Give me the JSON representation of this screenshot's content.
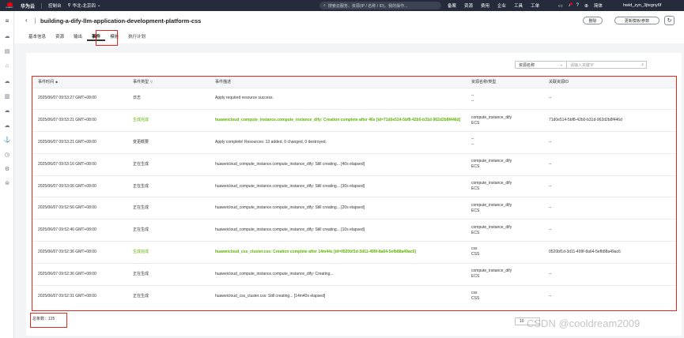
{
  "topbar": {
    "logo_text": "HUAWEI",
    "brand": "华为云",
    "console": "控制台",
    "region": "华北-北京四",
    "search_placeholder": "搜索云服务、资源(IP / 名称 / ID)、我的操作...",
    "nav": [
      "备案",
      "资源",
      "费用",
      "企业",
      "工具",
      "工单"
    ],
    "lang": "简体",
    "user": "hwid_zyn_3jtegny6f"
  },
  "header": {
    "title": "building-a-dify-llm-application-development-platform-css",
    "delete_label": "删除",
    "update_label": "更新模板/参数"
  },
  "tabs": [
    "基本信息",
    "资源",
    "输出",
    "事件",
    "模板",
    "执行计划"
  ],
  "active_tab": 3,
  "filter": {
    "select_value": "资源名称",
    "keyword_placeholder": "请输入关键字"
  },
  "table": {
    "columns": [
      "事件时间",
      "事件类型",
      "事件描述",
      "资源名称/类型",
      "关联资源ID"
    ],
    "rows": [
      {
        "time": "2025/06/07 09:53:27 GMT+08:00",
        "type": "日志",
        "type_color": "normal",
        "desc": "Apply required resource success.",
        "desc_color": "normal",
        "res_name": "--",
        "res_type": "--",
        "res_id": "--"
      },
      {
        "time": "2025/06/07 09:53:21 GMT+08:00",
        "type": "生成完成",
        "type_color": "green",
        "desc": "huaweicloud_compute_instance.compute_instance_dify: Creation complete after 46s [id=71d0e514-5bf8-42b0-b31d-962d2b8f446d]",
        "desc_color": "green",
        "res_name": "compute_instance_dify",
        "res_type": "ECS",
        "res_id": "71d0e514-5bf8-42b0-b31d-962d2b8f446d"
      },
      {
        "time": "2025/06/07 09:53:21 GMT+08:00",
        "type": "变更概要",
        "type_color": "normal",
        "desc": "Apply complete! Resources: 13 added, 0 changed, 0 destroyed.",
        "desc_color": "normal",
        "res_name": "--",
        "res_type": "--",
        "res_id": "--"
      },
      {
        "time": "2025/06/07 09:53:16 GMT+08:00",
        "type": "正在生成",
        "type_color": "normal",
        "desc": "huaweicloud_compute_instance.compute_instance_dify: Still creating... [40s elapsed]",
        "desc_color": "normal",
        "res_name": "compute_instance_dify",
        "res_type": "ECS",
        "res_id": "--"
      },
      {
        "time": "2025/06/07 09:53:06 GMT+08:00",
        "type": "正在生成",
        "type_color": "normal",
        "desc": "huaweicloud_compute_instance.compute_instance_dify: Still creating... [30s elapsed]",
        "desc_color": "normal",
        "res_name": "compute_instance_dify",
        "res_type": "ECS",
        "res_id": "--"
      },
      {
        "time": "2025/06/07 09:52:56 GMT+08:00",
        "type": "正在生成",
        "type_color": "normal",
        "desc": "huaweicloud_compute_instance.compute_instance_dify: Still creating... [20s elapsed]",
        "desc_color": "normal",
        "res_name": "compute_instance_dify",
        "res_type": "ECS",
        "res_id": "--"
      },
      {
        "time": "2025/06/07 09:52:46 GMT+08:00",
        "type": "正在生成",
        "type_color": "normal",
        "desc": "huaweicloud_compute_instance.compute_instance_dify: Still creating... [10s elapsed]",
        "desc_color": "normal",
        "res_name": "compute_instance_dify",
        "res_type": "ECS",
        "res_id": "--"
      },
      {
        "time": "2025/06/07 09:52:36 GMT+08:00",
        "type": "生成完成",
        "type_color": "green",
        "desc": "huaweicloud_css_cluster.css: Creation complete after 14m44s [id=0520bf1d-3d11-499f-8a64-5efb88a49ac6]",
        "desc_color": "green",
        "res_name": "css",
        "res_type": "CSS",
        "res_id": "0520bf1d-3d11-499f-8a64-5efb88a49ac6"
      },
      {
        "time": "2025/06/07 09:52:36 GMT+08:00",
        "type": "正在生成",
        "type_color": "normal",
        "desc": "huaweicloud_compute_instance.compute_instance_dify: Creating...",
        "desc_color": "normal",
        "res_name": "compute_instance_dify",
        "res_type": "ECS",
        "res_id": "--"
      },
      {
        "time": "2025/06/07 09:52:31 GMT+08:00",
        "type": "正在生成",
        "type_color": "normal",
        "desc": "huaweicloud_css_cluster.css: Still creating... [14m40s elapsed]",
        "desc_color": "normal",
        "res_name": "css",
        "res_type": "CSS",
        "res_id": "--"
      }
    ]
  },
  "footer": {
    "total_label": "总条数：125",
    "page_size": "10"
  },
  "watermark": "CSDN @cooldream2009",
  "colors": {
    "topbar_bg": "#252b3a",
    "success_green": "#5cb300",
    "highlight_red": "#e0281e"
  }
}
